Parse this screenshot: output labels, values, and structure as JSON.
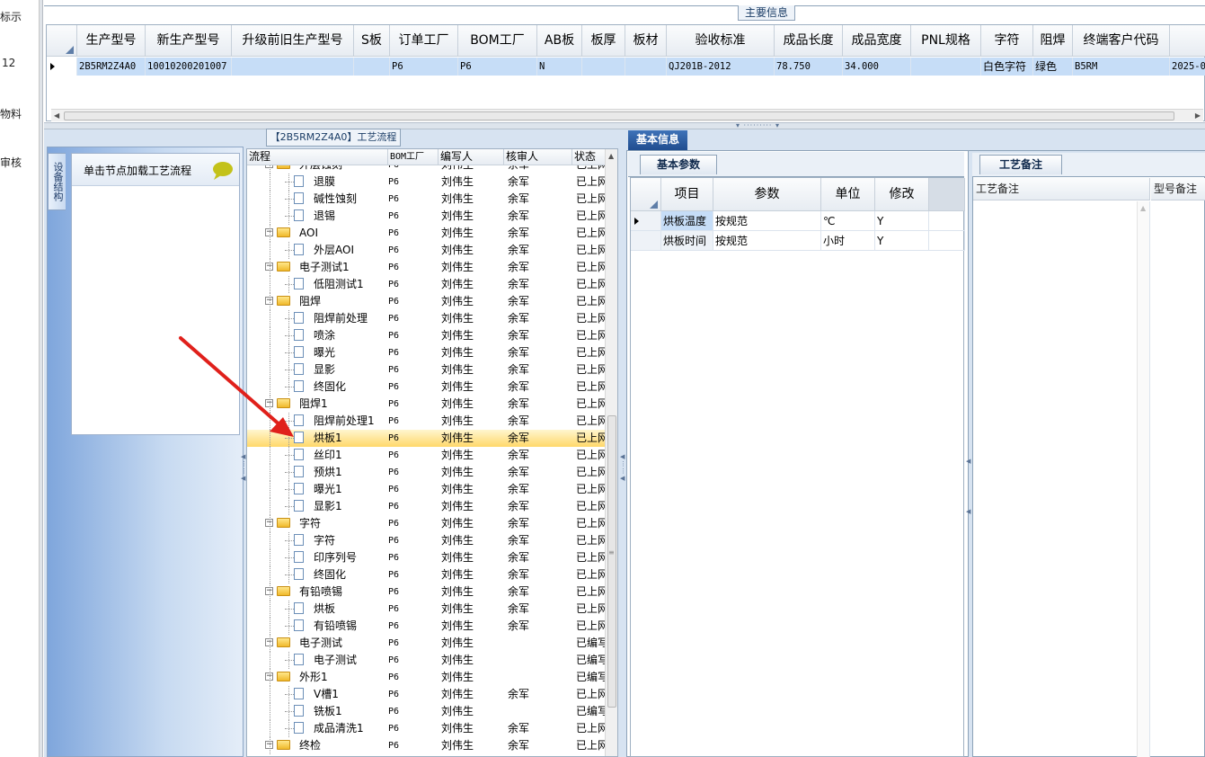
{
  "left_nav": {
    "items": [
      "标示",
      "12",
      "物料",
      "审核"
    ]
  },
  "main_info": {
    "group_title": "主要信息",
    "columns": [
      "生产型号",
      "新生产型号",
      "升级前旧生产型号",
      "S板",
      "订单工厂",
      "BOM工厂",
      "AB板",
      "板厚",
      "板材",
      "验收标准",
      "成品长度",
      "成品宽度",
      "PNL规格",
      "字符",
      "阻焊",
      "终端客户代码"
    ],
    "row": {
      "production_model": "2B5RM2Z4A0",
      "new_production_model": "10010200201007",
      "old_model": "",
      "s_board": "",
      "order_factory": "P6",
      "bom_factory": "P6",
      "ab_board": "N",
      "thickness": "",
      "material": "",
      "acceptance_standard": "QJ201B-2012",
      "length": "78.750",
      "width": "34.000",
      "pnl_spec": "",
      "character": "白色字符",
      "solder_mask": "绿色",
      "end_customer_code": "B5RM",
      "date_partial": "2025-0"
    }
  },
  "structure_panel": {
    "vertical_tab": "设备结构",
    "hint": "单击节点加载工艺流程"
  },
  "process_flow": {
    "title": "【2B5RM2Z4A0】工艺流程",
    "columns": [
      "流程",
      "BOM工厂",
      "编写人",
      "核审人",
      "状态"
    ],
    "rows": [
      {
        "level": 1,
        "type": "folder",
        "name": "外层蚀刻",
        "factory": "P6",
        "writer": "刘伟生",
        "reviewer": "余军",
        "status": "已上网"
      },
      {
        "level": 2,
        "type": "doc",
        "name": "退膜",
        "factory": "P6",
        "writer": "刘伟生",
        "reviewer": "余军",
        "status": "已上网"
      },
      {
        "level": 2,
        "type": "doc",
        "name": "碱性蚀刻",
        "factory": "P6",
        "writer": "刘伟生",
        "reviewer": "余军",
        "status": "已上网"
      },
      {
        "level": 2,
        "type": "doc",
        "name": "退锡",
        "factory": "P6",
        "writer": "刘伟生",
        "reviewer": "余军",
        "status": "已上网"
      },
      {
        "level": 1,
        "type": "folder",
        "name": "AOI",
        "factory": "P6",
        "writer": "刘伟生",
        "reviewer": "余军",
        "status": "已上网"
      },
      {
        "level": 2,
        "type": "doc",
        "name": "外层AOI",
        "factory": "P6",
        "writer": "刘伟生",
        "reviewer": "余军",
        "status": "已上网"
      },
      {
        "level": 1,
        "type": "folder",
        "name": "电子测试1",
        "factory": "P6",
        "writer": "刘伟生",
        "reviewer": "余军",
        "status": "已上网"
      },
      {
        "level": 2,
        "type": "doc",
        "name": "低阻测试1",
        "factory": "P6",
        "writer": "刘伟生",
        "reviewer": "余军",
        "status": "已上网"
      },
      {
        "level": 1,
        "type": "folder",
        "name": "阻焊",
        "factory": "P6",
        "writer": "刘伟生",
        "reviewer": "余军",
        "status": "已上网"
      },
      {
        "level": 2,
        "type": "doc",
        "name": "阻焊前处理",
        "factory": "P6",
        "writer": "刘伟生",
        "reviewer": "余军",
        "status": "已上网"
      },
      {
        "level": 2,
        "type": "doc",
        "name": "喷涂",
        "factory": "P6",
        "writer": "刘伟生",
        "reviewer": "余军",
        "status": "已上网"
      },
      {
        "level": 2,
        "type": "doc",
        "name": "曝光",
        "factory": "P6",
        "writer": "刘伟生",
        "reviewer": "余军",
        "status": "已上网"
      },
      {
        "level": 2,
        "type": "doc",
        "name": "显影",
        "factory": "P6",
        "writer": "刘伟生",
        "reviewer": "余军",
        "status": "已上网"
      },
      {
        "level": 2,
        "type": "doc",
        "name": "终固化",
        "factory": "P6",
        "writer": "刘伟生",
        "reviewer": "余军",
        "status": "已上网"
      },
      {
        "level": 1,
        "type": "folder",
        "name": "阻焊1",
        "factory": "P6",
        "writer": "刘伟生",
        "reviewer": "余军",
        "status": "已上网"
      },
      {
        "level": 2,
        "type": "doc",
        "name": "阻焊前处理1",
        "factory": "P6",
        "writer": "刘伟生",
        "reviewer": "余军",
        "status": "已上网"
      },
      {
        "level": 2,
        "type": "doc",
        "name": "烘板1",
        "factory": "P6",
        "writer": "刘伟生",
        "reviewer": "余军",
        "status": "已上网",
        "selected": true
      },
      {
        "level": 2,
        "type": "doc",
        "name": "丝印1",
        "factory": "P6",
        "writer": "刘伟生",
        "reviewer": "余军",
        "status": "已上网"
      },
      {
        "level": 2,
        "type": "doc",
        "name": "预烘1",
        "factory": "P6",
        "writer": "刘伟生",
        "reviewer": "余军",
        "status": "已上网"
      },
      {
        "level": 2,
        "type": "doc",
        "name": "曝光1",
        "factory": "P6",
        "writer": "刘伟生",
        "reviewer": "余军",
        "status": "已上网"
      },
      {
        "level": 2,
        "type": "doc",
        "name": "显影1",
        "factory": "P6",
        "writer": "刘伟生",
        "reviewer": "余军",
        "status": "已上网"
      },
      {
        "level": 1,
        "type": "folder",
        "name": "字符",
        "factory": "P6",
        "writer": "刘伟生",
        "reviewer": "余军",
        "status": "已上网"
      },
      {
        "level": 2,
        "type": "doc",
        "name": "字符",
        "factory": "P6",
        "writer": "刘伟生",
        "reviewer": "余军",
        "status": "已上网"
      },
      {
        "level": 2,
        "type": "doc",
        "name": "印序列号",
        "factory": "P6",
        "writer": "刘伟生",
        "reviewer": "余军",
        "status": "已上网"
      },
      {
        "level": 2,
        "type": "doc",
        "name": "终固化",
        "factory": "P6",
        "writer": "刘伟生",
        "reviewer": "余军",
        "status": "已上网"
      },
      {
        "level": 1,
        "type": "folder",
        "name": "有铅喷锡",
        "factory": "P6",
        "writer": "刘伟生",
        "reviewer": "余军",
        "status": "已上网"
      },
      {
        "level": 2,
        "type": "doc",
        "name": "烘板",
        "factory": "P6",
        "writer": "刘伟生",
        "reviewer": "余军",
        "status": "已上网"
      },
      {
        "level": 2,
        "type": "doc",
        "name": "有铅喷锡",
        "factory": "P6",
        "writer": "刘伟生",
        "reviewer": "余军",
        "status": "已上网"
      },
      {
        "level": 1,
        "type": "folder",
        "name": "电子测试",
        "factory": "P6",
        "writer": "刘伟生",
        "reviewer": "",
        "status": "已编写"
      },
      {
        "level": 2,
        "type": "doc",
        "name": "电子测试",
        "factory": "P6",
        "writer": "刘伟生",
        "reviewer": "",
        "status": "已编写"
      },
      {
        "level": 1,
        "type": "folder",
        "name": "外形1",
        "factory": "P6",
        "writer": "刘伟生",
        "reviewer": "",
        "status": "已编写"
      },
      {
        "level": 2,
        "type": "doc",
        "name": "V槽1",
        "factory": "P6",
        "writer": "刘伟生",
        "reviewer": "余军",
        "status": "已上网"
      },
      {
        "level": 2,
        "type": "doc",
        "name": "铣板1",
        "factory": "P6",
        "writer": "刘伟生",
        "reviewer": "",
        "status": "已编写"
      },
      {
        "level": 2,
        "type": "doc",
        "name": "成品清洗1",
        "factory": "P6",
        "writer": "刘伟生",
        "reviewer": "余军",
        "status": "已上网"
      },
      {
        "level": 1,
        "type": "folder",
        "name": "终检",
        "factory": "P6",
        "writer": "刘伟生",
        "reviewer": "余军",
        "status": "已上网"
      }
    ]
  },
  "basic_info": {
    "tab": "基本信息",
    "subtab": "基本参数",
    "columns": [
      "项目",
      "参数",
      "单位",
      "修改"
    ],
    "rows": [
      {
        "item": "烘板温度",
        "param": "按规范",
        "unit": "℃",
        "modify": "Y"
      },
      {
        "item": "烘板时间",
        "param": "按规范",
        "unit": "小时",
        "modify": "Y"
      }
    ]
  },
  "process_notes": {
    "tab": "工艺备注",
    "columns": [
      "工艺备注",
      "型号备注"
    ]
  },
  "colors": {
    "selection": "#c6ddf7",
    "tree_selection": "#ffd86a",
    "tab_active": "#204d8f",
    "annotation_arrow": "#e0201b"
  }
}
